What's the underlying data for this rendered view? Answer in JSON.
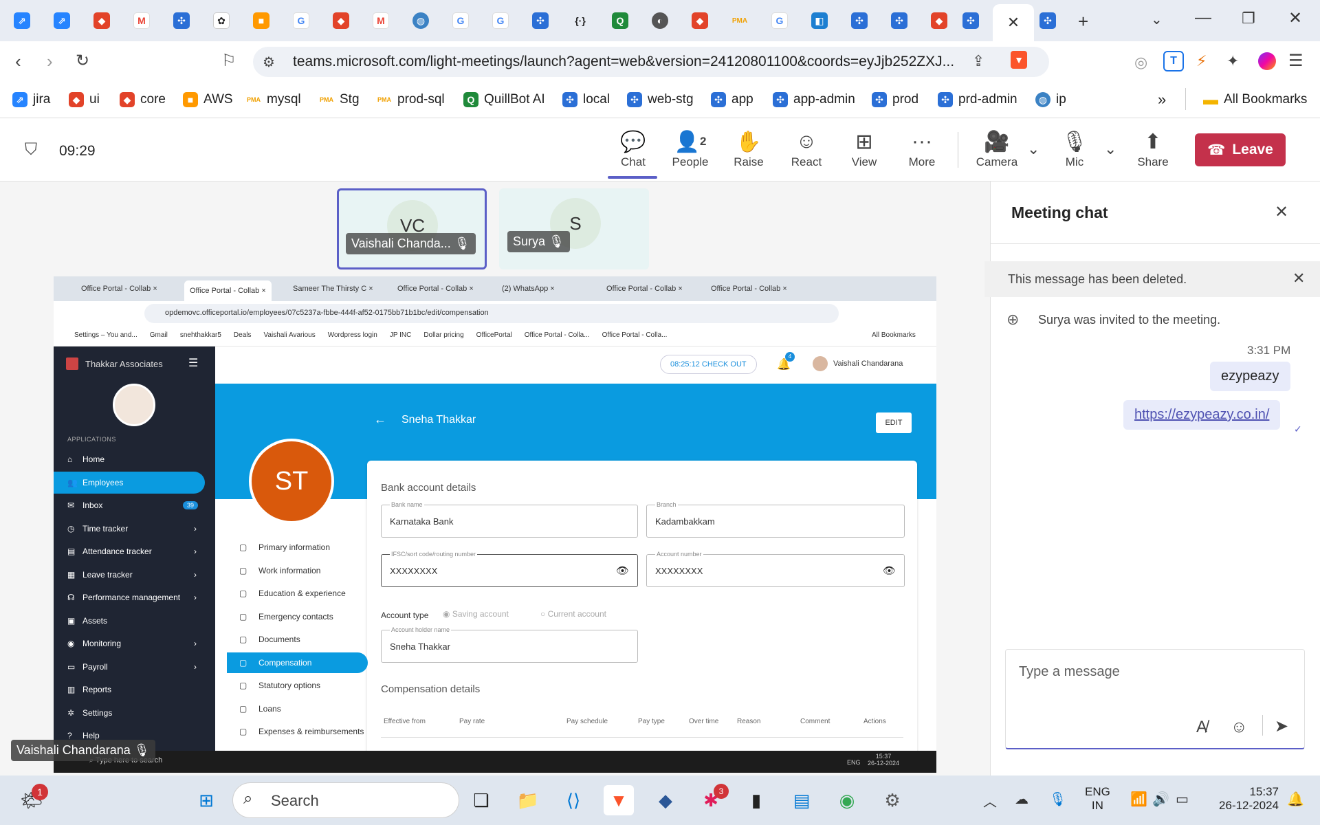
{
  "browser": {
    "url": "teams.microsoft.com/light-meetings/launch?agent=web&version=24120801100&coords=eyJjb252ZXJ...",
    "bookmarks": [
      "jira",
      "ui",
      "core",
      "AWS",
      "mysql",
      "Stg",
      "prod-sql",
      "QuillBot AI",
      "local",
      "web-stg",
      "app",
      "app-admin",
      "prod",
      "prd-admin",
      "ip"
    ],
    "all_bookmarks": "All Bookmarks",
    "more_bookmarks": "»"
  },
  "meeting": {
    "time": "09:29",
    "buttons": {
      "chat": "Chat",
      "people": "People",
      "people_count": "2",
      "raise": "Raise",
      "react": "React",
      "view": "View",
      "more": "More",
      "camera": "Camera",
      "mic": "Mic",
      "share": "Share",
      "leave": "Leave"
    },
    "participants": [
      {
        "initials": "VC",
        "name": "Vaishali Chanda..."
      },
      {
        "initials": "S",
        "name": "Surya"
      }
    ],
    "presenter_name": "Vaishali Chandarana"
  },
  "shared_screen": {
    "tabs": [
      "Office Portal - Collab",
      "Office Portal - Collab",
      "Sameer The Thirsty C",
      "Office Portal - Collab",
      "(2) WhatsApp",
      "Office Portal - Collab",
      "Office Portal - Collab"
    ],
    "url": "opdemovc.officeportal.io/employees/07c5237a-fbbe-444f-af52-0175bb71b1bc/edit/compensation",
    "bookmarks": [
      "Settings – You and...",
      "Gmail",
      "snehthakkar5",
      "Deals",
      "Vaishali Avarious",
      "Wordpress login",
      "JP INC",
      "Dollar pricing",
      "OfficePortal",
      "Office Portal - Colla...",
      "Office Portal - Colla..."
    ],
    "all_bookmarks": "All Bookmarks",
    "company": "Thakkar Associates",
    "applications_label": "APPLICATIONS",
    "checkout": "08:25:12 CHECK OUT",
    "notif_count": "4",
    "user": "Vaishali Chandarana",
    "nav": [
      {
        "label": "Home",
        "icon": "⌂"
      },
      {
        "label": "Employees",
        "icon": "👥"
      },
      {
        "label": "Inbox",
        "icon": "✉",
        "badge": "39"
      },
      {
        "label": "Time tracker",
        "icon": "◷",
        "chevron": "›"
      },
      {
        "label": "Attendance tracker",
        "icon": "▤",
        "chevron": "›"
      },
      {
        "label": "Leave tracker",
        "icon": "▦",
        "chevron": "›"
      },
      {
        "label": "Performance management",
        "icon": "☊",
        "chevron": "›"
      },
      {
        "label": "Assets",
        "icon": "▣"
      },
      {
        "label": "Monitoring",
        "icon": "◉",
        "chevron": "›"
      },
      {
        "label": "Payroll",
        "icon": "▭",
        "chevron": "›"
      },
      {
        "label": "Reports",
        "icon": "▥"
      },
      {
        "label": "Settings",
        "icon": "✲"
      },
      {
        "label": "Help",
        "icon": "?"
      }
    ],
    "employee_name": "Sneha Thakkar",
    "employee_initials": "ST",
    "edit_label": "EDIT",
    "sections": [
      "Primary information",
      "Work information",
      "Education & experience",
      "Emergency contacts",
      "Documents",
      "Compensation",
      "Statutory options",
      "Loans",
      "Expenses & reimbursements"
    ],
    "bank_title": "Bank account details",
    "bank_name_label": "Bank name",
    "bank_name": "Karnataka Bank",
    "branch_label": "Branch",
    "branch": "Kadambakkam",
    "ifsc_label": "IFSC/sort code/routing number",
    "ifsc": "XXXXXXXX",
    "account_label": "Account number",
    "account": "XXXXXXXX",
    "account_type_label": "Account type",
    "saving": "Saving account",
    "current": "Current account",
    "holder_label": "Account holder name",
    "holder": "Sneha Thakkar",
    "comp_title": "Compensation details",
    "comp_cols": [
      "Effective from",
      "Pay rate",
      "Pay schedule",
      "Pay type",
      "Over time",
      "Reason",
      "Comment",
      "Actions"
    ],
    "taskbar_search": "Type here to search",
    "clock_time": "15:37",
    "clock_date": "26-12-2024",
    "lang": "ENG"
  },
  "chat": {
    "title": "Meeting chat",
    "deleted_notice": "This message has been deleted.",
    "invite_notice": "Surya was invited to the meeting.",
    "timestamp": "3:31 PM",
    "messages": [
      "ezypeazy",
      "https://ezypeazy.co.in/"
    ],
    "input_placeholder": "Type a message"
  },
  "taskbar": {
    "search": "Search",
    "lang": "ENG",
    "region": "IN",
    "time": "15:37",
    "date": "26-12-2024",
    "notif_badge": "1",
    "slack_badge": "3"
  }
}
